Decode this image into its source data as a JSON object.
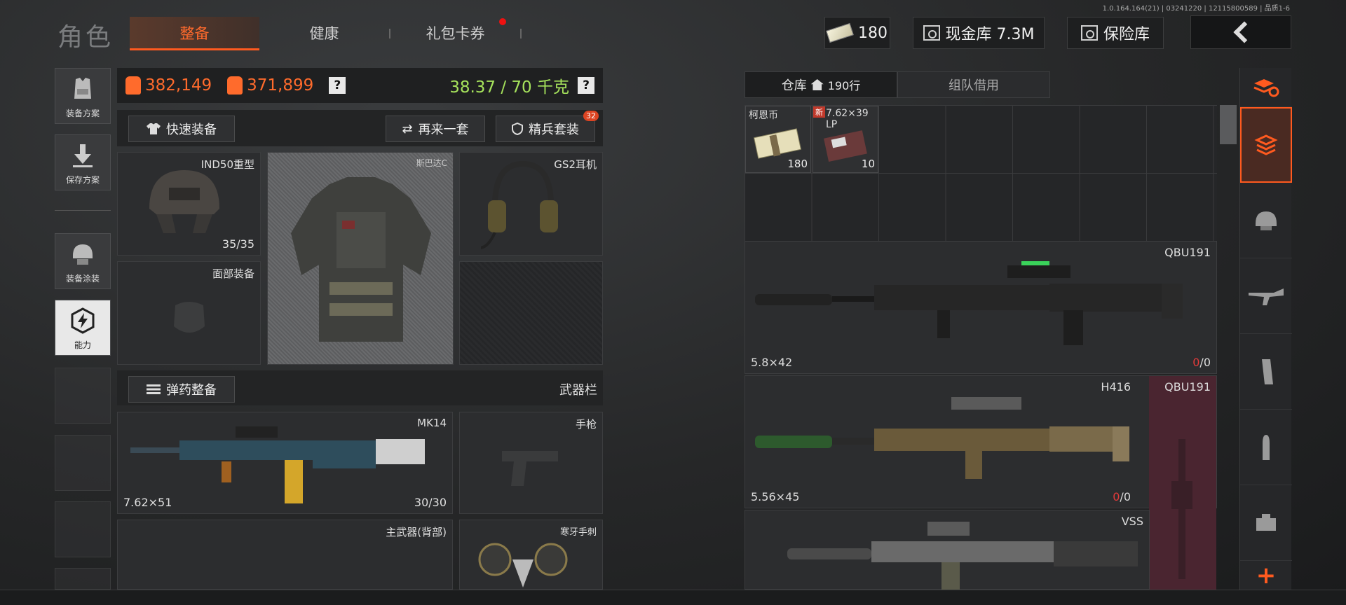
{
  "version": "1.0.164.164(21) | 03241220 | 12115800589 | 品质1-6",
  "title": "角色",
  "tabs": [
    {
      "label": "整备",
      "active": true
    },
    {
      "label": "健康",
      "active": false
    },
    {
      "label": "礼包卡券",
      "active": false,
      "has_dot": true
    }
  ],
  "currency": {
    "koen_amount": "180",
    "cash_vault": "现金库 7.3M",
    "safe_box": "保险库"
  },
  "side_buttons": [
    {
      "label": "装备方案",
      "icon": "vest-icon"
    },
    {
      "label": "保存方案",
      "icon": "download-icon"
    },
    {
      "label": "装备涂装",
      "icon": "helmet-paint-icon"
    },
    {
      "label": "能力",
      "icon": "lightning-hexagon-icon"
    }
  ],
  "stats": {
    "value_a": "382,149",
    "value_b": "371,899",
    "weight": "38.37 / 70 千克",
    "help": "?"
  },
  "actions": {
    "quick_equip": "快速装备",
    "another_set": "再来一套",
    "elite_set": "精兵套装",
    "elite_badge": "32"
  },
  "slots": {
    "helmet": {
      "name": "IND50重型",
      "durability": "35/35"
    },
    "armor": {
      "name": "斯巴达C"
    },
    "headset": {
      "name": "GS2耳机"
    },
    "face": {
      "name": "面部装备"
    },
    "ammo_button": "弹药整备",
    "weapon_bar": "武器栏",
    "primary": {
      "name": "MK14",
      "caliber": "7.62×51",
      "ammo": "30/30"
    },
    "pistol": {
      "name": "手枪"
    },
    "back_weapon": {
      "name": "主武器(背部)"
    },
    "melee": {
      "name": "寒牙手刺"
    }
  },
  "inventory": {
    "tab_storage": "仓库",
    "rows": "190行",
    "tab_team": "组队借用",
    "items": [
      {
        "name": "柯恩币",
        "qty": "180"
      },
      {
        "name": "7.62×39 LP",
        "qty": "10",
        "new_tag": "新"
      }
    ],
    "guns": [
      {
        "name": "QBU191",
        "caliber": "5.8×42",
        "ammo_red": "0",
        "ammo_rest": "/0"
      },
      {
        "name": "H416",
        "side_name": "QBU191",
        "caliber": "5.56×45",
        "ammo_red": "0",
        "ammo_rest": "/0"
      },
      {
        "name": "VSS"
      }
    ]
  },
  "colors": {
    "accent": "#ff5a1f",
    "weight": "#a6e35c",
    "value": "#ff6b2c"
  }
}
